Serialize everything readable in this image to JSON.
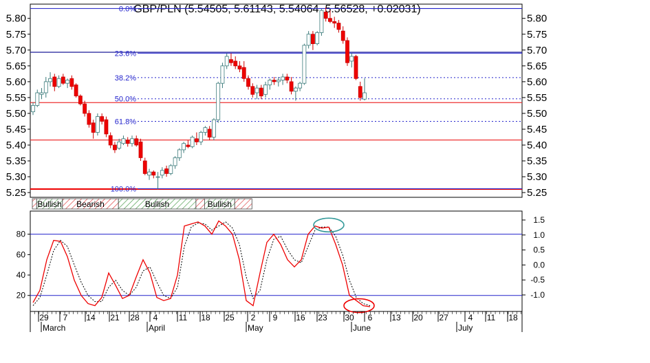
{
  "chart_data": {
    "type": "candlestick",
    "title": "GBP/PLN (5.54505, 5.61143, 5.54064, 5.56528, +0.02031)",
    "price_axis": {
      "ylim": [
        5.235,
        5.845
      ],
      "ticks": [
        "5.80",
        "5.75",
        "5.70",
        "5.65",
        "5.60",
        "5.55",
        "5.50",
        "5.45",
        "5.40",
        "5.35",
        "5.30",
        "5.25"
      ],
      "tick_values": [
        5.8,
        5.75,
        5.7,
        5.65,
        5.6,
        5.55,
        5.5,
        5.45,
        5.4,
        5.35,
        5.3,
        5.25
      ]
    },
    "fibonacci": {
      "color": "#2222cc",
      "levels": [
        {
          "label": "0.0%",
          "value": 5.831
        },
        {
          "label": "23.6%",
          "value": 5.69
        },
        {
          "label": "38.2%",
          "value": 5.613
        },
        {
          "label": "50.0%",
          "value": 5.546
        },
        {
          "label": "61.8%",
          "value": 5.475
        },
        {
          "label": "100.0%",
          "value": 5.262
        }
      ]
    },
    "horizontal_lines": [
      {
        "value": 5.831,
        "color": "#3333cc"
      },
      {
        "value": 5.693,
        "color": "#1a1a99"
      },
      {
        "value": 5.534,
        "color": "#ee3333"
      },
      {
        "value": 5.416,
        "color": "#ee3333"
      },
      {
        "value": 5.261,
        "color": "#ee0000"
      }
    ],
    "candles": [
      {
        "o": 5.505,
        "h": 5.535,
        "l": 5.495,
        "c": 5.525
      },
      {
        "o": 5.525,
        "h": 5.575,
        "l": 5.52,
        "c": 5.565
      },
      {
        "o": 5.56,
        "h": 5.58,
        "l": 5.545,
        "c": 5.565
      },
      {
        "o": 5.565,
        "h": 5.615,
        "l": 5.55,
        "c": 5.6
      },
      {
        "o": 5.6,
        "h": 5.63,
        "l": 5.585,
        "c": 5.61
      },
      {
        "o": 5.615,
        "h": 5.625,
        "l": 5.57,
        "c": 5.585
      },
      {
        "o": 5.585,
        "h": 5.62,
        "l": 5.58,
        "c": 5.61
      },
      {
        "o": 5.615,
        "h": 5.625,
        "l": 5.59,
        "c": 5.595
      },
      {
        "o": 5.595,
        "h": 5.61,
        "l": 5.58,
        "c": 5.605
      },
      {
        "o": 5.61,
        "h": 5.62,
        "l": 5.575,
        "c": 5.585
      },
      {
        "o": 5.59,
        "h": 5.595,
        "l": 5.55,
        "c": 5.555
      },
      {
        "o": 5.555,
        "h": 5.56,
        "l": 5.525,
        "c": 5.53
      },
      {
        "o": 5.53,
        "h": 5.54,
        "l": 5.49,
        "c": 5.5
      },
      {
        "o": 5.5,
        "h": 5.51,
        "l": 5.455,
        "c": 5.465
      },
      {
        "o": 5.47,
        "h": 5.48,
        "l": 5.42,
        "c": 5.44
      },
      {
        "o": 5.44,
        "h": 5.5,
        "l": 5.43,
        "c": 5.49
      },
      {
        "o": 5.49,
        "h": 5.5,
        "l": 5.465,
        "c": 5.475
      },
      {
        "o": 5.48,
        "h": 5.49,
        "l": 5.425,
        "c": 5.435
      },
      {
        "o": 5.43,
        "h": 5.44,
        "l": 5.39,
        "c": 5.4
      },
      {
        "o": 5.4,
        "h": 5.41,
        "l": 5.375,
        "c": 5.385
      },
      {
        "o": 5.39,
        "h": 5.42,
        "l": 5.385,
        "c": 5.41
      },
      {
        "o": 5.405,
        "h": 5.43,
        "l": 5.4,
        "c": 5.42
      },
      {
        "o": 5.415,
        "h": 5.425,
        "l": 5.395,
        "c": 5.405
      },
      {
        "o": 5.405,
        "h": 5.43,
        "l": 5.395,
        "c": 5.42
      },
      {
        "o": 5.42,
        "h": 5.43,
        "l": 5.395,
        "c": 5.4
      },
      {
        "o": 5.41,
        "h": 5.42,
        "l": 5.35,
        "c": 5.36
      },
      {
        "o": 5.35,
        "h": 5.36,
        "l": 5.305,
        "c": 5.31
      },
      {
        "o": 5.305,
        "h": 5.325,
        "l": 5.29,
        "c": 5.315
      },
      {
        "o": 5.315,
        "h": 5.32,
        "l": 5.295,
        "c": 5.305
      },
      {
        "o": 5.3,
        "h": 5.315,
        "l": 5.26,
        "c": 5.3
      },
      {
        "o": 5.305,
        "h": 5.33,
        "l": 5.295,
        "c": 5.32
      },
      {
        "o": 5.325,
        "h": 5.335,
        "l": 5.3,
        "c": 5.31
      },
      {
        "o": 5.31,
        "h": 5.34,
        "l": 5.305,
        "c": 5.335
      },
      {
        "o": 5.335,
        "h": 5.365,
        "l": 5.325,
        "c": 5.36
      },
      {
        "o": 5.36,
        "h": 5.39,
        "l": 5.35,
        "c": 5.385
      },
      {
        "o": 5.385,
        "h": 5.41,
        "l": 5.375,
        "c": 5.405
      },
      {
        "o": 5.4,
        "h": 5.415,
        "l": 5.39,
        "c": 5.395
      },
      {
        "o": 5.395,
        "h": 5.43,
        "l": 5.39,
        "c": 5.425
      },
      {
        "o": 5.42,
        "h": 5.44,
        "l": 5.4,
        "c": 5.41
      },
      {
        "o": 5.41,
        "h": 5.445,
        "l": 5.4,
        "c": 5.44
      },
      {
        "o": 5.44,
        "h": 5.46,
        "l": 5.43,
        "c": 5.455
      },
      {
        "o": 5.45,
        "h": 5.46,
        "l": 5.415,
        "c": 5.425
      },
      {
        "o": 5.425,
        "h": 5.485,
        "l": 5.415,
        "c": 5.48
      },
      {
        "o": 5.48,
        "h": 5.6,
        "l": 5.47,
        "c": 5.595
      },
      {
        "o": 5.595,
        "h": 5.66,
        "l": 5.58,
        "c": 5.65
      },
      {
        "o": 5.65,
        "h": 5.69,
        "l": 5.64,
        "c": 5.68
      },
      {
        "o": 5.67,
        "h": 5.69,
        "l": 5.65,
        "c": 5.66
      },
      {
        "o": 5.665,
        "h": 5.68,
        "l": 5.64,
        "c": 5.65
      },
      {
        "o": 5.65,
        "h": 5.665,
        "l": 5.63,
        "c": 5.64
      },
      {
        "o": 5.645,
        "h": 5.665,
        "l": 5.6,
        "c": 5.61
      },
      {
        "o": 5.61,
        "h": 5.62,
        "l": 5.575,
        "c": 5.585
      },
      {
        "o": 5.585,
        "h": 5.595,
        "l": 5.55,
        "c": 5.56
      },
      {
        "o": 5.565,
        "h": 5.59,
        "l": 5.545,
        "c": 5.58
      },
      {
        "o": 5.58,
        "h": 5.59,
        "l": 5.545,
        "c": 5.555
      },
      {
        "o": 5.56,
        "h": 5.6,
        "l": 5.55,
        "c": 5.59
      },
      {
        "o": 5.59,
        "h": 5.61,
        "l": 5.575,
        "c": 5.605
      },
      {
        "o": 5.605,
        "h": 5.615,
        "l": 5.59,
        "c": 5.6
      },
      {
        "o": 5.6,
        "h": 5.615,
        "l": 5.585,
        "c": 5.605
      },
      {
        "o": 5.605,
        "h": 5.625,
        "l": 5.59,
        "c": 5.615
      },
      {
        "o": 5.615,
        "h": 5.625,
        "l": 5.595,
        "c": 5.605
      },
      {
        "o": 5.6,
        "h": 5.615,
        "l": 5.56,
        "c": 5.57
      },
      {
        "o": 5.57,
        "h": 5.585,
        "l": 5.54,
        "c": 5.58
      },
      {
        "o": 5.58,
        "h": 5.6,
        "l": 5.57,
        "c": 5.595
      },
      {
        "o": 5.595,
        "h": 5.72,
        "l": 5.59,
        "c": 5.715
      },
      {
        "o": 5.715,
        "h": 5.76,
        "l": 5.705,
        "c": 5.75
      },
      {
        "o": 5.75,
        "h": 5.76,
        "l": 5.7,
        "c": 5.72
      },
      {
        "o": 5.72,
        "h": 5.76,
        "l": 5.715,
        "c": 5.755
      },
      {
        "o": 5.755,
        "h": 5.83,
        "l": 5.745,
        "c": 5.825
      },
      {
        "o": 5.82,
        "h": 5.835,
        "l": 5.79,
        "c": 5.8
      },
      {
        "o": 5.8,
        "h": 5.825,
        "l": 5.785,
        "c": 5.79
      },
      {
        "o": 5.79,
        "h": 5.805,
        "l": 5.77,
        "c": 5.785
      },
      {
        "o": 5.785,
        "h": 5.795,
        "l": 5.755,
        "c": 5.765
      },
      {
        "o": 5.76,
        "h": 5.775,
        "l": 5.72,
        "c": 5.73
      },
      {
        "o": 5.73,
        "h": 5.74,
        "l": 5.65,
        "c": 5.66
      },
      {
        "o": 5.665,
        "h": 5.69,
        "l": 5.645,
        "c": 5.68
      },
      {
        "o": 5.68,
        "h": 5.685,
        "l": 5.605,
        "c": 5.61
      },
      {
        "o": 5.585,
        "h": 5.6,
        "l": 5.54,
        "c": 5.55
      },
      {
        "o": 5.545,
        "h": 5.611,
        "l": 5.541,
        "c": 5.565
      }
    ],
    "signal_bar": [
      {
        "label": "",
        "kind": "bear",
        "days": 1
      },
      {
        "label": "Bullish",
        "kind": "bull",
        "days": 6
      },
      {
        "label": "Bearish",
        "kind": "bear",
        "days": 13
      },
      {
        "label": "Bullish",
        "kind": "bull",
        "days": 18
      },
      {
        "label": "",
        "kind": "bear",
        "days": 2
      },
      {
        "label": "Bullish",
        "kind": "bull",
        "days": 7
      },
      {
        "label": "",
        "kind": "bear",
        "days": 4
      }
    ],
    "oscillator": {
      "left_ylim": [
        5,
        102
      ],
      "left_ticks": [
        "80",
        "60",
        "40",
        "20"
      ],
      "left_tick_values": [
        80,
        60,
        40,
        20
      ],
      "right_ticks": [
        "1.5",
        "1.0",
        "0.5",
        "0.0",
        "-0.5",
        "-1.0"
      ],
      "right_tick_values": [
        1.5,
        1.0,
        0.5,
        0.0,
        -0.5,
        -1.0
      ],
      "levels": [
        80,
        20
      ],
      "level_color": "#2222cc",
      "k_color": "#ee0000",
      "k": [
        13,
        25,
        55,
        74,
        73,
        58,
        35,
        20,
        12,
        10,
        18,
        42,
        30,
        17,
        20,
        38,
        55,
        42,
        18,
        15,
        17,
        40,
        88,
        90,
        92,
        88,
        80,
        93,
        88,
        80,
        55,
        15,
        10,
        42,
        72,
        80,
        70,
        55,
        48,
        55,
        80,
        88,
        86,
        87,
        70,
        50,
        20,
        15,
        10,
        9
      ],
      "d": [
        10,
        18,
        40,
        64,
        74,
        68,
        50,
        33,
        20,
        14,
        14,
        28,
        35,
        25,
        20,
        28,
        44,
        48,
        33,
        20,
        17,
        28,
        68,
        87,
        91,
        90,
        84,
        88,
        92,
        86,
        70,
        38,
        17,
        25,
        55,
        75,
        78,
        65,
        55,
        52,
        68,
        84,
        87,
        87,
        78,
        60,
        35,
        18,
        12,
        10
      ],
      "highlights": [
        {
          "index": 43,
          "value": 89,
          "color": "#339999"
        },
        {
          "index": 47,
          "value": 10,
          "color": "#ee0000"
        }
      ]
    },
    "time_axis": {
      "day_labels": [
        "29",
        "7",
        "14",
        "21",
        "28",
        "4",
        "11",
        "18",
        "25",
        "2",
        "9",
        "16",
        "23",
        "30",
        "6",
        "13",
        "20",
        "27",
        "4",
        "11",
        "18"
      ],
      "month_labels": [
        "March",
        "April",
        "May",
        "June",
        "July"
      ]
    }
  }
}
